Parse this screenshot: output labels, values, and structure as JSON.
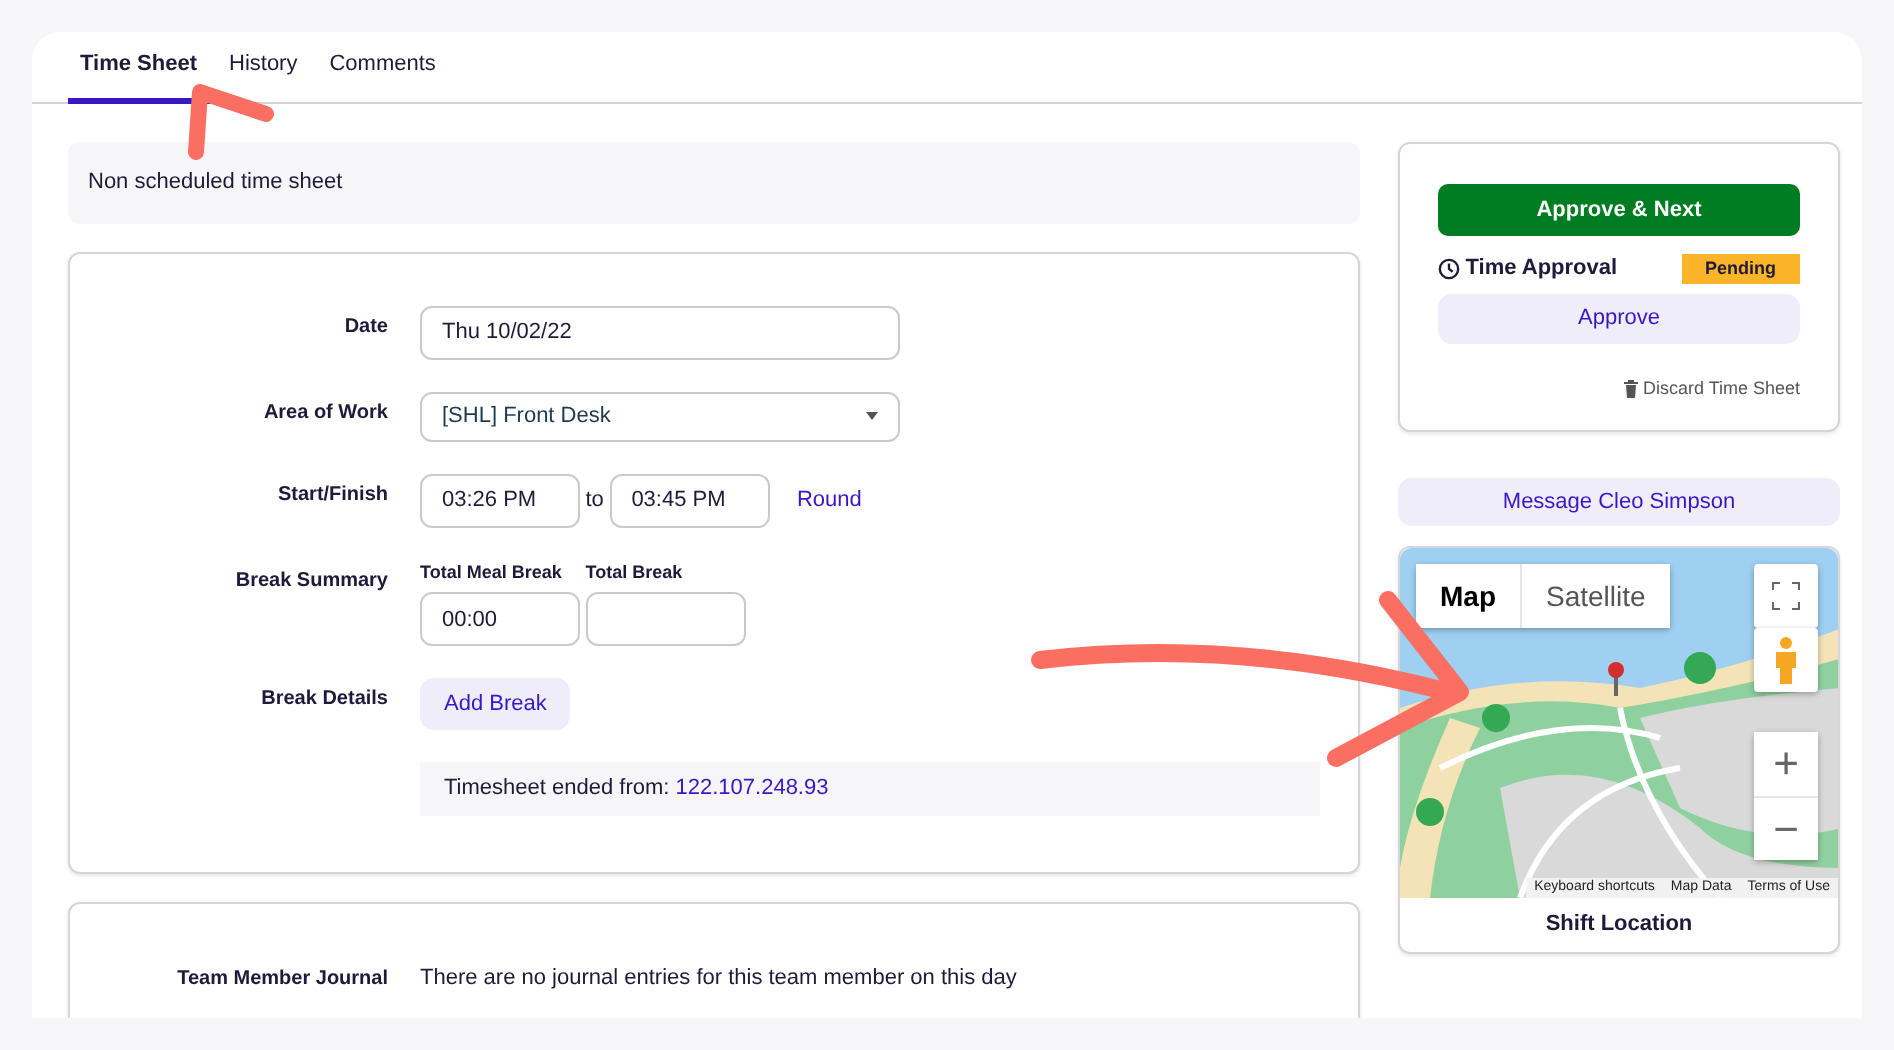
{
  "tabs": [
    {
      "label": "Time Sheet",
      "selected": true
    },
    {
      "label": "History",
      "selected": false
    },
    {
      "label": "Comments",
      "selected": false
    }
  ],
  "notice": "Non scheduled time sheet",
  "form": {
    "date": {
      "label": "Date",
      "value": "Thu 10/02/22"
    },
    "area": {
      "label": "Area of Work",
      "value": "[SHL] Front Desk"
    },
    "start_finish": {
      "label": "Start/Finish",
      "start": "03:26 PM",
      "separator": "to",
      "finish": "03:45 PM",
      "round_link": "Round"
    },
    "break_summary": {
      "label": "Break Summary",
      "fields": [
        {
          "label": "Total Meal Break",
          "value": "00:00"
        },
        {
          "label": "Total Break"
        }
      ]
    },
    "break_details": {
      "label": "Break Details",
      "button": "Add Break"
    },
    "ended_from": {
      "text": "Timesheet ended from:",
      "ip": "122.107.248.93"
    }
  },
  "journal": {
    "label": "Team Member Journal",
    "text": "There are no journal entries for this team member on this day"
  },
  "approval": {
    "primary_button": "Approve & Next",
    "title": "Time Approval",
    "status": "Pending",
    "approve_button": "Approve",
    "discard_link": "Discard Time Sheet"
  },
  "message_button": "Message Cleo Simpson",
  "map": {
    "kind": "picture",
    "map_types": [
      {
        "label": "Map",
        "selected": true
      },
      {
        "label": "Satellite",
        "selected": false
      }
    ],
    "attribution": [
      "Keyboard shortcuts",
      "Map Data",
      "Terms of Use"
    ],
    "zoom_in": "+",
    "zoom_out": "−",
    "caption": "Shift Location"
  }
}
